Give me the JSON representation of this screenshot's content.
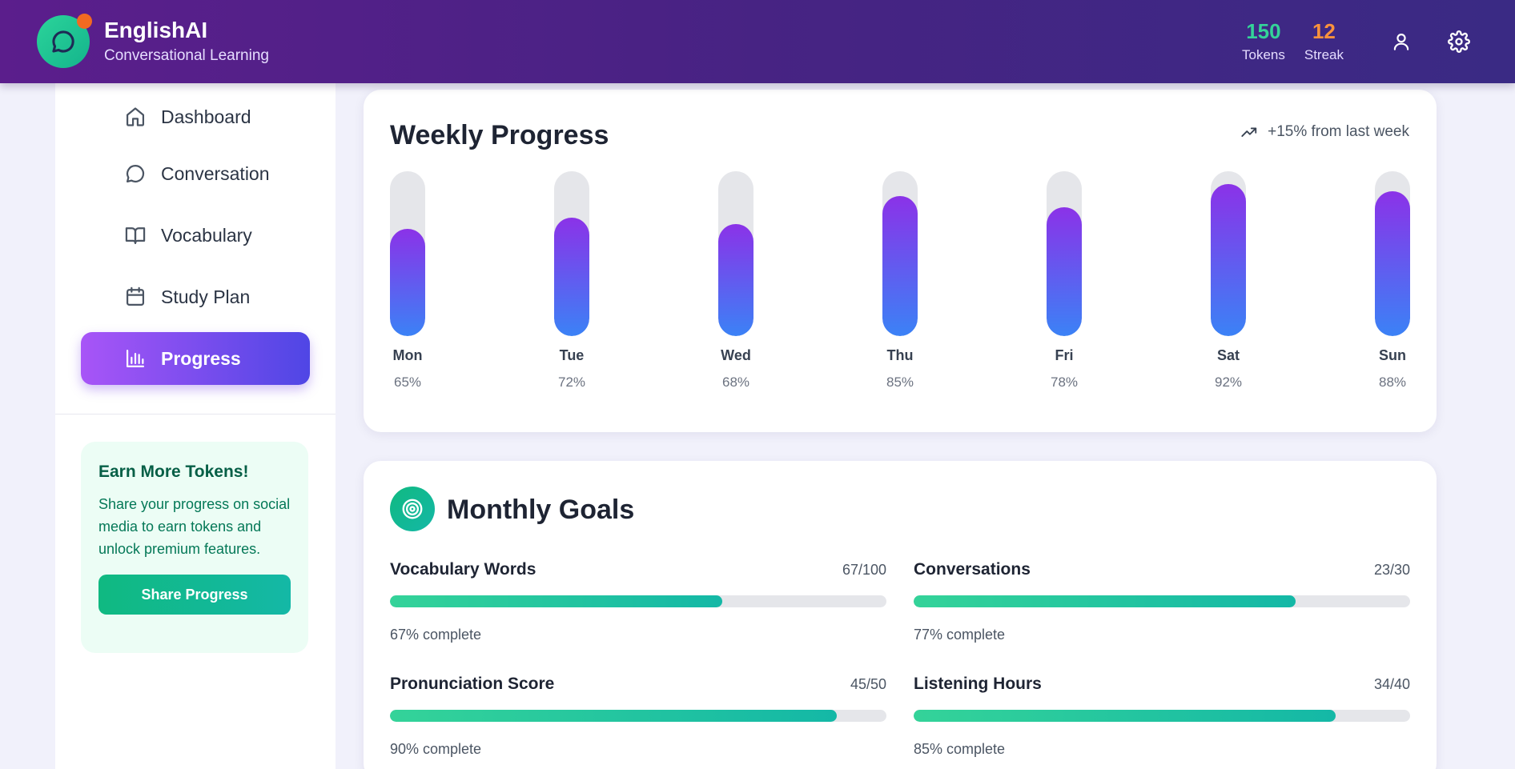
{
  "header": {
    "app_name": "EnglishAI",
    "app_subtitle": "Conversational Learning",
    "tokens_value": "150",
    "tokens_label": "Tokens",
    "streak_value": "12",
    "streak_label": "Streak",
    "icons": [
      "chat-bubble-icon",
      "user-icon",
      "gear-icon"
    ]
  },
  "sidebar": {
    "items": [
      {
        "label": "Dashboard",
        "icon": "home-icon"
      },
      {
        "label": "Conversation",
        "icon": "chat-bubble-icon"
      },
      {
        "label": "Vocabulary",
        "icon": "book-icon"
      },
      {
        "label": "Study Plan",
        "icon": "calendar-icon"
      },
      {
        "label": "Progress",
        "icon": "bar-chart-icon",
        "active": true
      }
    ],
    "promo": {
      "title": "Earn More Tokens!",
      "text": "Share your progress on social media to earn tokens and unlock premium features.",
      "button": "Share Progress"
    }
  },
  "weekly": {
    "title": "Weekly Progress",
    "trend": "+15% from last week",
    "days": [
      {
        "label": "Mon",
        "pct_text": "65%",
        "value": 65
      },
      {
        "label": "Tue",
        "pct_text": "72%",
        "value": 72
      },
      {
        "label": "Wed",
        "pct_text": "68%",
        "value": 68
      },
      {
        "label": "Thu",
        "pct_text": "85%",
        "value": 85
      },
      {
        "label": "Fri",
        "pct_text": "78%",
        "value": 78
      },
      {
        "label": "Sat",
        "pct_text": "92%",
        "value": 92
      },
      {
        "label": "Sun",
        "pct_text": "88%",
        "value": 88
      }
    ]
  },
  "monthly": {
    "title": "Monthly Goals",
    "goals": [
      {
        "name": "Vocabulary Words",
        "count": "67/100",
        "pct_text": "67% complete",
        "value": 67
      },
      {
        "name": "Conversations",
        "count": "23/30",
        "pct_text": "77% complete",
        "value": 77
      },
      {
        "name": "Pronunciation Score",
        "count": "45/50",
        "pct_text": "90% complete",
        "value": 90
      },
      {
        "name": "Listening Hours",
        "count": "34/40",
        "pct_text": "85% complete",
        "value": 85
      }
    ]
  },
  "colors": {
    "header_gradient": [
      "#5b1e8c",
      "#3a2a84"
    ],
    "accent_green": "#10b981",
    "accent_purple": "#8b32e8",
    "accent_blue": "#3b82f6",
    "tokens": "#34d399",
    "streak": "#fb923c"
  }
}
